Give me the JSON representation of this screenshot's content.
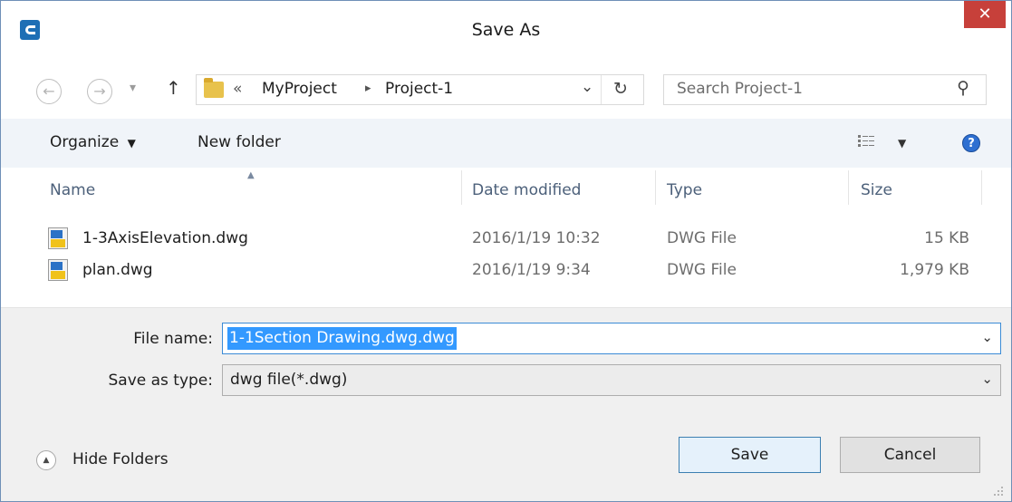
{
  "window": {
    "title": "Save As",
    "close_glyph": "✕"
  },
  "nav": {
    "back_glyph": "←",
    "forward_glyph": "→",
    "recent_glyph": "▾",
    "up_glyph": "↑",
    "path_prefix": "«",
    "path": [
      "MyProject",
      "Project-1"
    ],
    "path_sep": "▸",
    "dropdown_glyph": "⌄",
    "refresh_glyph": "↻",
    "search_placeholder": "Search Project-1",
    "search_glyph": "⚲"
  },
  "toolbar": {
    "organize_label": "Organize",
    "organize_arrow": "▼",
    "new_folder_label": "New folder",
    "view_arrow": "▼",
    "help_glyph": "?"
  },
  "columns": {
    "name": "Name",
    "sort_glyph": "▲",
    "date": "Date modified",
    "type": "Type",
    "size": "Size"
  },
  "files": [
    {
      "name": "1-3AxisElevation.dwg",
      "date": "2016/1/19 10:32",
      "type": "DWG File",
      "size": "15 KB"
    },
    {
      "name": "plan.dwg",
      "date": "2016/1/19 9:34",
      "type": "DWG File",
      "size": "1,979 KB"
    }
  ],
  "form": {
    "file_name_label": "File name:",
    "file_name_value": "1-1Section Drawing.dwg.dwg",
    "save_type_label": "Save as type:",
    "save_type_value": "dwg file(*.dwg)",
    "chevron_glyph": "⌄"
  },
  "footer": {
    "hide_folders_label": "Hide Folders",
    "hide_glyph": "▲",
    "save_label": "Save",
    "cancel_label": "Cancel"
  },
  "colors": {
    "accent": "#3399ff",
    "close": "#c7403a",
    "folder": "#e8c24c",
    "header_text": "#4c607a"
  }
}
